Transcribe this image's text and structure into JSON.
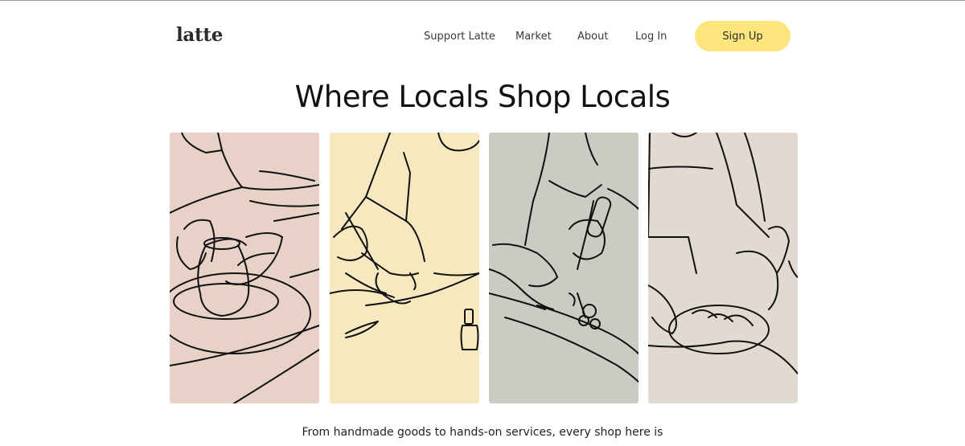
{
  "header": {
    "logo": "latte",
    "nav": [
      {
        "label": "Support Latte"
      },
      {
        "label": "Market"
      },
      {
        "label": "About"
      },
      {
        "label": "Log In"
      }
    ],
    "signup_label": "Sign Up"
  },
  "hero": {
    "title": "Where Locals Shop Locals",
    "subtitle": "From handmade goods to hands-on services, every shop here is"
  },
  "panels": [
    {
      "name": "pottery-illustration",
      "bg": "#e8d2c8"
    },
    {
      "name": "nail-art-illustration",
      "bg": "#f6e9bf"
    },
    {
      "name": "tattoo-illustration",
      "bg": "#c8ccc3"
    },
    {
      "name": "baking-illustration",
      "bg": "#e2d9d1"
    }
  ],
  "colors": {
    "accent": "#fbe57c",
    "text": "#1a1a1a"
  }
}
